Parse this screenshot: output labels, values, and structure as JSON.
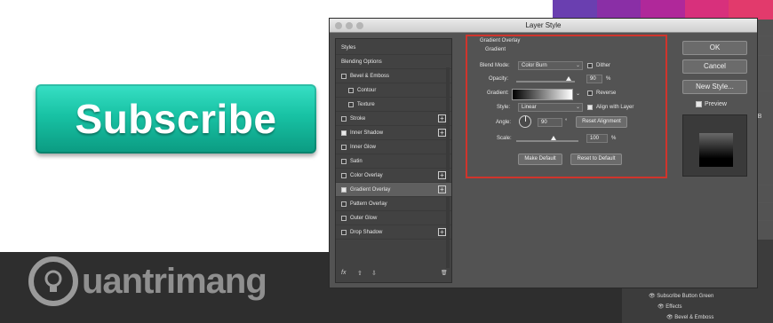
{
  "dialog": {
    "title": "Layer Style",
    "styles_list": [
      {
        "label": "Styles",
        "checkbox": false,
        "checked": false,
        "plus": false
      },
      {
        "label": "Blending Options",
        "checkbox": false,
        "checked": false,
        "plus": false
      },
      {
        "label": "Bevel & Emboss",
        "checkbox": true,
        "checked": false,
        "plus": false
      },
      {
        "label": "Contour",
        "checkbox": true,
        "checked": false,
        "plus": false,
        "indent": true
      },
      {
        "label": "Texture",
        "checkbox": true,
        "checked": false,
        "plus": false,
        "indent": true
      },
      {
        "label": "Stroke",
        "checkbox": true,
        "checked": false,
        "plus": true
      },
      {
        "label": "Inner Shadow",
        "checkbox": true,
        "checked": true,
        "plus": true
      },
      {
        "label": "Inner Glow",
        "checkbox": true,
        "checked": false,
        "plus": false
      },
      {
        "label": "Satin",
        "checkbox": true,
        "checked": false,
        "plus": false
      },
      {
        "label": "Color Overlay",
        "checkbox": true,
        "checked": false,
        "plus": true
      },
      {
        "label": "Gradient Overlay",
        "checkbox": true,
        "checked": true,
        "plus": true,
        "active": true
      },
      {
        "label": "Pattern Overlay",
        "checkbox": true,
        "checked": false,
        "plus": false
      },
      {
        "label": "Outer Glow",
        "checkbox": true,
        "checked": false,
        "plus": false
      },
      {
        "label": "Drop Shadow",
        "checkbox": true,
        "checked": false,
        "plus": true
      }
    ],
    "footer": {
      "fx": "fx",
      "up": "⇧",
      "down": "⇩",
      "trash": "🗑"
    },
    "gradient_overlay": {
      "section_title": "Gradient Overlay",
      "subsection_title": "Gradient",
      "blend_mode_label": "Blend Mode:",
      "blend_mode_value": "Color Burn",
      "dither_label": "Dither",
      "dither_checked": false,
      "opacity_label": "Opacity:",
      "opacity_value": "90",
      "opacity_unit": "%",
      "opacity_fraction": 0.9,
      "gradient_label": "Gradient:",
      "reverse_label": "Reverse",
      "reverse_checked": false,
      "style_label": "Style:",
      "style_value": "Linear",
      "align_label": "Align with Layer",
      "align_checked": true,
      "angle_label": "Angle:",
      "angle_value": "90",
      "angle_unit": "°",
      "reset_alignment_label": "Reset Alignment",
      "scale_label": "Scale:",
      "scale_value": "100",
      "scale_unit": "%",
      "make_default_label": "Make Default",
      "reset_default_label": "Reset to Default"
    },
    "buttons": {
      "ok": "OK",
      "cancel": "Cancel",
      "new_style": "New Style...",
      "preview_label": "Preview",
      "preview_checked": true
    }
  },
  "canvas": {
    "button_text": "Subscribe",
    "watermark_text": "uantrimang"
  },
  "background_panel": {
    "kb_label": "KB",
    "layer_name": "Subscribe Button Green",
    "effects_label": "Effects",
    "bevel_label": "Bevel & Emboss"
  },
  "colors": {
    "subscribe_green": "#18c2a4",
    "highlight_red": "#d0342c",
    "swatches": [
      "#6a3fb0",
      "#8a2fa6",
      "#b0289a",
      "#d8307c",
      "#e23a6c"
    ]
  }
}
